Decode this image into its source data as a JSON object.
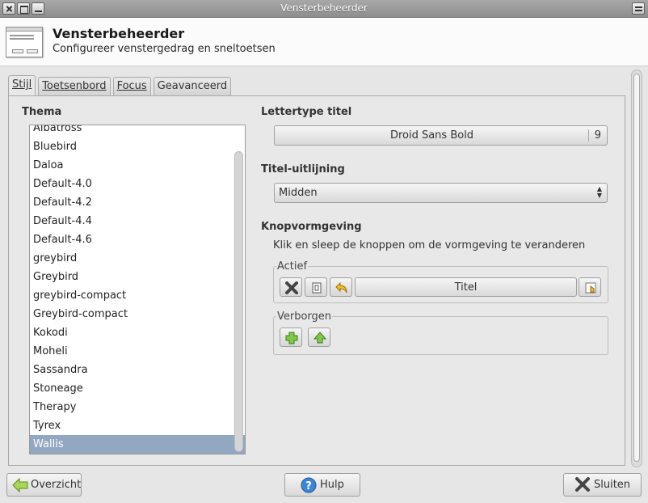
{
  "window": {
    "title": "Vensterbeheerder"
  },
  "header": {
    "title": "Vensterbeheerder",
    "subtitle": "Configureer venstergedrag en sneltoetsen"
  },
  "tabs": [
    {
      "label": "Stijl",
      "active": true
    },
    {
      "label": "Toetsenbord",
      "active": false
    },
    {
      "label": "Focus",
      "active": false
    },
    {
      "label": "Geavanceerd",
      "active": false
    }
  ],
  "theme": {
    "label": "Thema",
    "items": [
      "Albatross",
      "Bluebird",
      "Daloa",
      "Default-4.0",
      "Default-4.2",
      "Default-4.4",
      "Default-4.6",
      "greybird",
      "Greybird",
      "greybird-compact",
      "Greybird-compact",
      "Kokodi",
      "Moheli",
      "Sassandra",
      "Stoneage",
      "Therapy",
      "Tyrex",
      "Wallis"
    ],
    "selected": "Wallis"
  },
  "title_font": {
    "label": "Lettertype titel",
    "font_name": "Droid Sans Bold",
    "font_size": "9"
  },
  "title_alignment": {
    "label": "Titel-uitlijning",
    "value": "Midden"
  },
  "button_layout": {
    "label": "Knopvormgeving",
    "hint": "Klik en sleep de knoppen om de vormgeving te veranderen",
    "active_label": "Actief",
    "title_button": "Titel",
    "hidden_label": "Verborgen"
  },
  "footer": {
    "overview": "Overzicht",
    "help": "Hulp",
    "close": "Sluiten"
  },
  "colors": {
    "selection": "#92a7c2",
    "titlebar": "#9a9a9a"
  }
}
